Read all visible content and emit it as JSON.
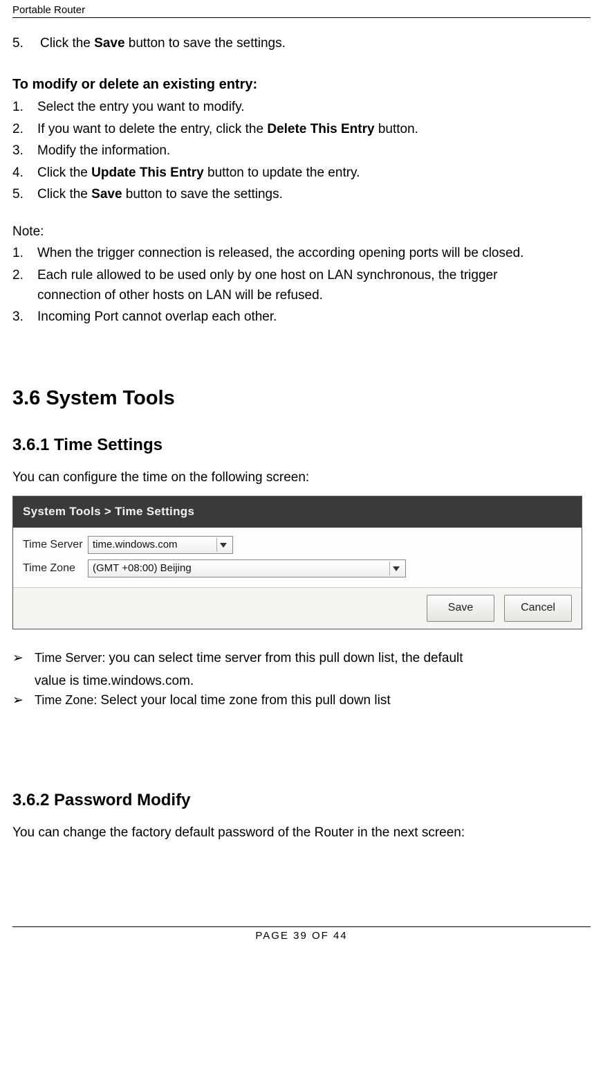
{
  "header": {
    "title": "Portable Router"
  },
  "step5": {
    "num": "5.",
    "pre": "Click the ",
    "bold": "Save",
    "post": " button to save the settings."
  },
  "modify_heading": "To modify or delete an existing entry:",
  "modify_steps": {
    "s1": {
      "num": "1.",
      "text": "Select the entry you want to modify."
    },
    "s2": {
      "num": "2.",
      "pre": "If you want to delete the entry, click the ",
      "bold": "Delete This Entry",
      "post": " button."
    },
    "s3": {
      "num": "3.",
      "text": "Modify the information."
    },
    "s4": {
      "num": "4.",
      "pre": "Click the ",
      "bold": "Update This Entry",
      "post": " button to update the entry."
    },
    "s5": {
      "num": "5.",
      "pre": "Click the ",
      "bold": "Save",
      "post": " button to save the settings."
    }
  },
  "note_label": "Note:",
  "notes": {
    "n1": {
      "num": "1.",
      "text": "When the trigger connection is released, the according opening ports will be closed."
    },
    "n2": {
      "num": "2.",
      "line1": "Each rule allowed to be used only by one host on LAN synchronous, the trigger",
      "line2": "connection of other hosts on LAN will be refused."
    },
    "n3": {
      "num": "3.",
      "text": "Incoming Port cannot overlap each other."
    }
  },
  "h_major": "3.6   System Tools",
  "h_time": "3.6.1 Time Settings",
  "time_intro": "You can configure the time on the following screen:",
  "ui": {
    "titlebar": "System Tools > Time Settings",
    "time_server_label": "Time Server",
    "time_server_value": "time.windows.com",
    "time_zone_label": "Time Zone",
    "time_zone_value": "(GMT +08:00) Beijing",
    "save_btn": "Save",
    "cancel_btn": "Cancel"
  },
  "bullets": {
    "b1": {
      "label": "Time Server: ",
      "line1_rest": "you can select time server from this pull down list, the default",
      "line2": "value is time.windows.com."
    },
    "b2": {
      "label": "Time Zone: ",
      "rest": "Select your local time zone from this pull down list"
    }
  },
  "h_pw": "3.6.2 Password Modify",
  "pw_intro": "You can change the factory default password of the Router in the next screen:",
  "footer": "PAGE    39    OF    44"
}
